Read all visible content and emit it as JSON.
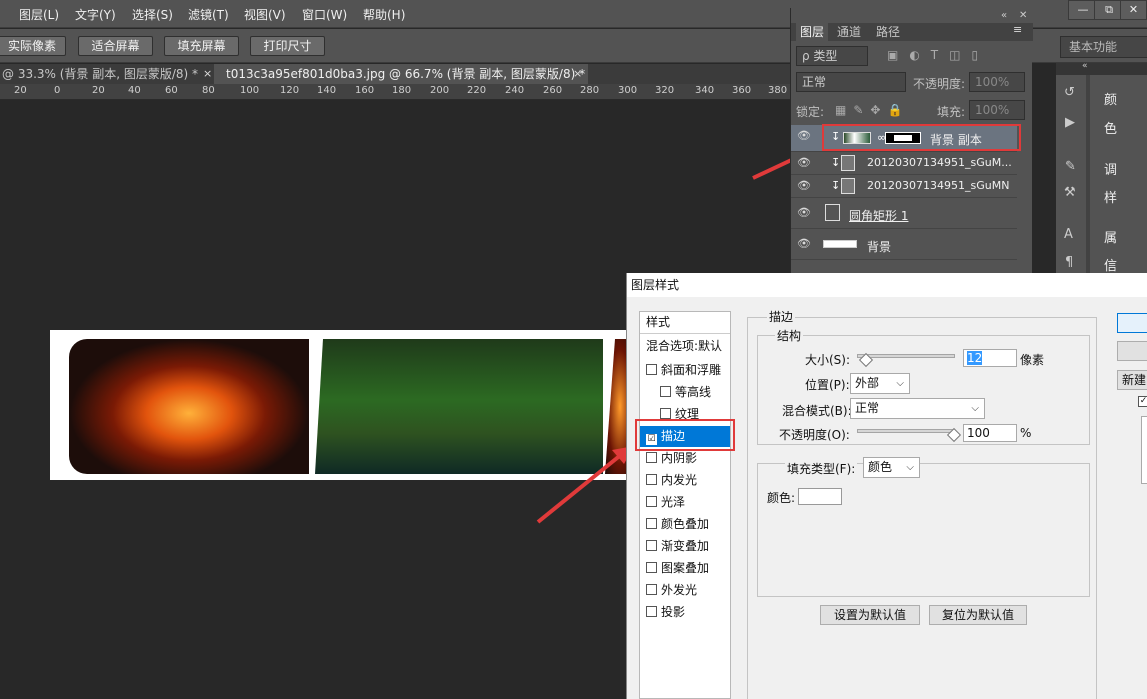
{
  "menu": [
    "图层(L)",
    "文字(Y)",
    "选择(S)",
    "滤镜(T)",
    "视图(V)",
    "窗口(W)",
    "帮助(H)"
  ],
  "window_controls": [
    "—",
    "⧉",
    "✕"
  ],
  "options_bar": {
    "buttons": [
      "实际像素",
      "适合屏幕",
      "填充屏幕",
      "打印尺寸"
    ],
    "workspace": "基本功能"
  },
  "tabs": [
    {
      "label": "@ 33.3% (背景 副本, 图层蒙版/8) *",
      "close": "×"
    },
    {
      "label": "t013c3a95ef801d0ba3.jpg @ 66.7% (背景 副本, 图层蒙版/8) *",
      "close": "×"
    }
  ],
  "ruler_ticks": [
    "20",
    "0",
    "20",
    "40",
    "60",
    "80",
    "100",
    "120",
    "140",
    "160",
    "180",
    "200",
    "220",
    "240",
    "260",
    "280",
    "300",
    "320",
    "340",
    "360",
    "380"
  ],
  "layers_panel": {
    "tabs": [
      "图层",
      "通道",
      "路径"
    ],
    "filter_label": "ρ 类型",
    "blend_mode": "正常",
    "opacity_label": "不透明度:",
    "opacity_value": "100%",
    "lock_label": "锁定:",
    "fill_label": "填充:",
    "fill_value": "100%",
    "layers": [
      {
        "name": "背景 副本"
      },
      {
        "name": "20120307134951_sGuM..."
      },
      {
        "name": "20120307134951_sGuMN"
      },
      {
        "name": "圆角矩形 1"
      },
      {
        "name": "背景"
      }
    ]
  },
  "right_dock": {
    "items": [
      "颜",
      "色",
      "调",
      "样",
      "属",
      "信"
    ]
  },
  "dialog": {
    "title": "图层样式",
    "styles_header": "样式",
    "blend_options": "混合选项:默认",
    "styles": [
      {
        "label": "斜面和浮雕",
        "checked": "",
        "indent": false
      },
      {
        "label": "等高线",
        "checked": "",
        "indent": true
      },
      {
        "label": "纹理",
        "checked": "",
        "indent": true
      },
      {
        "label": "描边",
        "checked": "☑",
        "indent": false
      },
      {
        "label": "内阴影",
        "checked": "",
        "indent": false
      },
      {
        "label": "内发光",
        "checked": "",
        "indent": false
      },
      {
        "label": "光泽",
        "checked": "",
        "indent": false
      },
      {
        "label": "颜色叠加",
        "checked": "",
        "indent": false
      },
      {
        "label": "渐变叠加",
        "checked": "",
        "indent": false
      },
      {
        "label": "图案叠加",
        "checked": "",
        "indent": false
      },
      {
        "label": "外发光",
        "checked": "",
        "indent": false
      },
      {
        "label": "投影",
        "checked": "",
        "indent": false
      }
    ],
    "stroke_title": "描边",
    "structure_title": "结构",
    "size_label": "大小(S):",
    "size_value": "12",
    "size_unit": "像素",
    "position_label": "位置(P):",
    "position_value": "外部",
    "blend_label": "混合模式(B):",
    "blend_value": "正常",
    "opacity_label": "不透明度(O):",
    "opacity_value": "100",
    "opacity_unit": "%",
    "fill_type_label": "填充类型(F):",
    "fill_type_value": "颜色",
    "color_label": "颜色:",
    "set_default": "设置为默认值",
    "reset_default": "复位为默认值",
    "side_button": "新建"
  },
  "colors": {
    "highlight": "#e03a3a",
    "selection_blue": "#0078d7"
  }
}
